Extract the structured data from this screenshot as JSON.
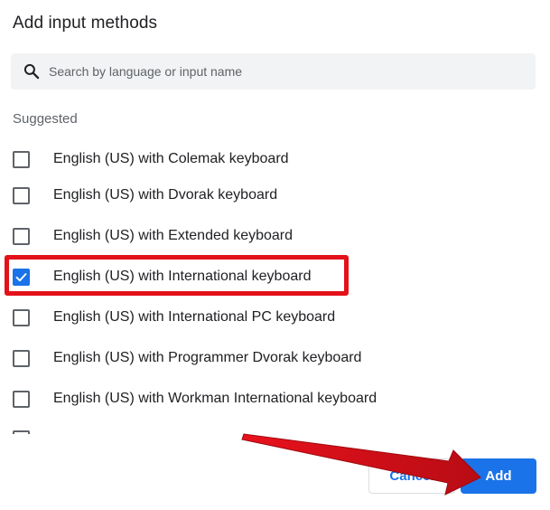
{
  "dialog": {
    "title": "Add input methods",
    "search": {
      "placeholder": "Search by language or input name",
      "value": "",
      "icon": "search-icon"
    },
    "section_label": "Suggested",
    "items": [
      {
        "label": "English (US) with Colemak keyboard",
        "checked": false
      },
      {
        "label": "English (US) with Dvorak keyboard",
        "checked": false
      },
      {
        "label": "English (US) with Extended keyboard",
        "checked": false
      },
      {
        "label": "English (US) with International keyboard",
        "checked": true
      },
      {
        "label": "English (US) with International PC keyboard",
        "checked": false
      },
      {
        "label": "English (US) with Programmer Dvorak keyboard",
        "checked": false
      },
      {
        "label": "English (US) with Workman International keyboard",
        "checked": false
      }
    ],
    "buttons": {
      "cancel_label": "Cancel",
      "add_label": "Add"
    }
  },
  "annotation": {
    "highlight_color": "#e3121a",
    "arrow_color": "#d50f18",
    "highlighted_item": "English (US) with International keyboard"
  },
  "colors": {
    "accent": "#1a73e8",
    "text": "#202124",
    "secondary_text": "#5f6368",
    "search_bg": "#f1f3f4"
  }
}
